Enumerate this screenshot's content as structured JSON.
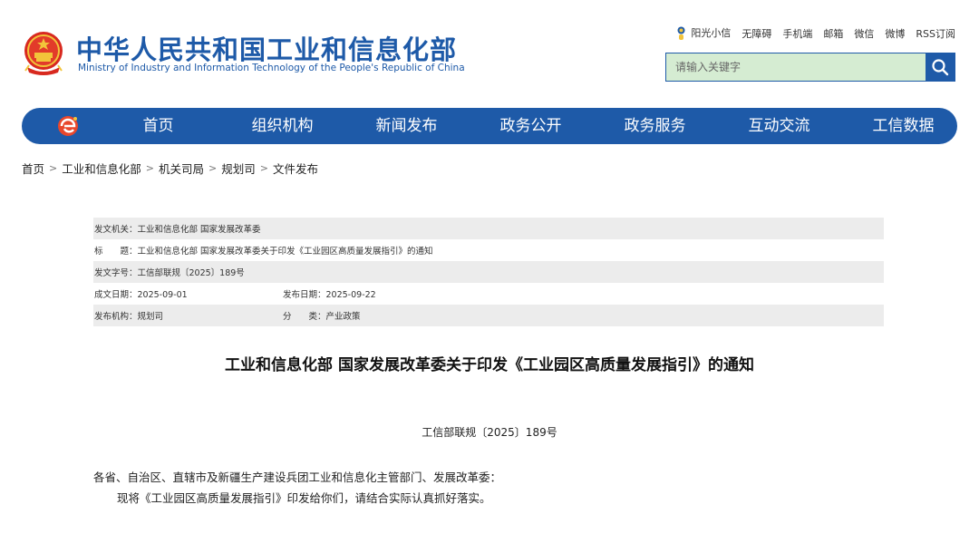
{
  "header": {
    "title": "中华人民共和国工业和信息化部",
    "subtitle": "Ministry of Industry and Information Technology of the People's Republic of China",
    "toplinks": [
      "阳光小信",
      "无障碍",
      "手机端",
      "邮箱",
      "微信",
      "微博",
      "RSS订阅"
    ],
    "search_placeholder": "请输入关键字",
    "brand_color": "#1e5aa8"
  },
  "nav": {
    "items": [
      "首页",
      "组织机构",
      "新闻发布",
      "政务公开",
      "政务服务",
      "互动交流",
      "工信数据"
    ]
  },
  "breadcrumb": [
    "首页",
    "工业和信息化部",
    "机关司局",
    "规划司",
    "文件发布"
  ],
  "meta": {
    "issuer": "发文机关：工业和信息化部 国家发展改革委",
    "title": "标　　题：工业和信息化部 国家发展改革委关于印发《工业园区高质量发展指引》的通知",
    "doc_no": "发文字号：工信部联规〔2025〕189号",
    "written_date": "成文日期：2025-09-01",
    "publish_date": "发布日期：2025-09-22",
    "agency": "发布机构：规划司",
    "category": "分　　类：产业政策"
  },
  "article": {
    "title": "工业和信息化部 国家发展改革委关于印发《工业园区高质量发展指引》的通知",
    "doc_number": "工信部联规〔2025〕189号",
    "para1": "各省、自治区、直辖市及新疆生产建设兵团工业和信息化主管部门、发展改革委：",
    "para2": "现将《工业园区高质量发展指引》印发给你们，请结合实际认真抓好落实。"
  }
}
